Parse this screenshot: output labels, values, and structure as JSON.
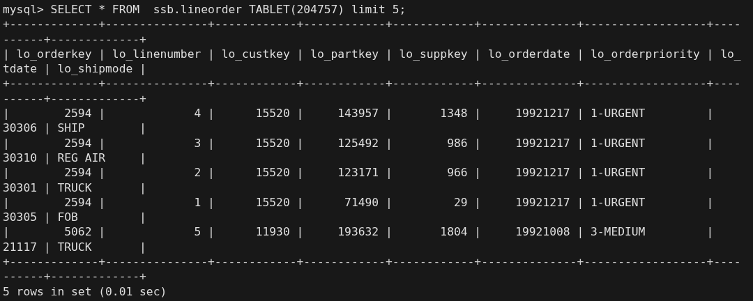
{
  "terminal": {
    "lines": [
      {
        "kind": "command",
        "text": "mysql> SELECT * FROM  ssb.lineorder TABLET(204757) limit 5;"
      },
      {
        "kind": "border",
        "text": "+-------------+---------------+------------+------------+------------+--------------+------------------+----"
      },
      {
        "kind": "border",
        "text": "------+-------------+"
      },
      {
        "kind": "header",
        "text": "| lo_orderkey | lo_linenumber | lo_custkey | lo_partkey | lo_suppkey | lo_orderdate | lo_orderpriority | lo_"
      },
      {
        "kind": "header",
        "text": "tdate | lo_shipmode |"
      },
      {
        "kind": "border",
        "text": "+-------------+---------------+------------+------------+------------+--------------+------------------+----"
      },
      {
        "kind": "border",
        "text": "------+-------------+"
      },
      {
        "kind": "row",
        "text": "|        2594 |             4 |      15520 |     143957 |       1348 |     19921217 | 1-URGENT         |"
      },
      {
        "kind": "row",
        "text": "30306 | SHIP        |"
      },
      {
        "kind": "row",
        "text": "|        2594 |             3 |      15520 |     125492 |        986 |     19921217 | 1-URGENT         |"
      },
      {
        "kind": "row",
        "text": "30310 | REG AIR     |"
      },
      {
        "kind": "row",
        "text": "|        2594 |             2 |      15520 |     123171 |        966 |     19921217 | 1-URGENT         |"
      },
      {
        "kind": "row",
        "text": "30301 | TRUCK       |"
      },
      {
        "kind": "row",
        "text": "|        2594 |             1 |      15520 |      71490 |         29 |     19921217 | 1-URGENT         |"
      },
      {
        "kind": "row",
        "text": "30305 | FOB         |"
      },
      {
        "kind": "row",
        "text": "|        5062 |             5 |      11930 |     193632 |       1804 |     19921008 | 3-MEDIUM         |"
      },
      {
        "kind": "row",
        "text": "21117 | TRUCK       |"
      },
      {
        "kind": "border",
        "text": "+-------------+---------------+------------+------------+------------+--------------+------------------+----"
      },
      {
        "kind": "border",
        "text": "------+-------------+"
      },
      {
        "kind": "output",
        "text": "5 rows in set (0.01 sec)"
      }
    ]
  }
}
